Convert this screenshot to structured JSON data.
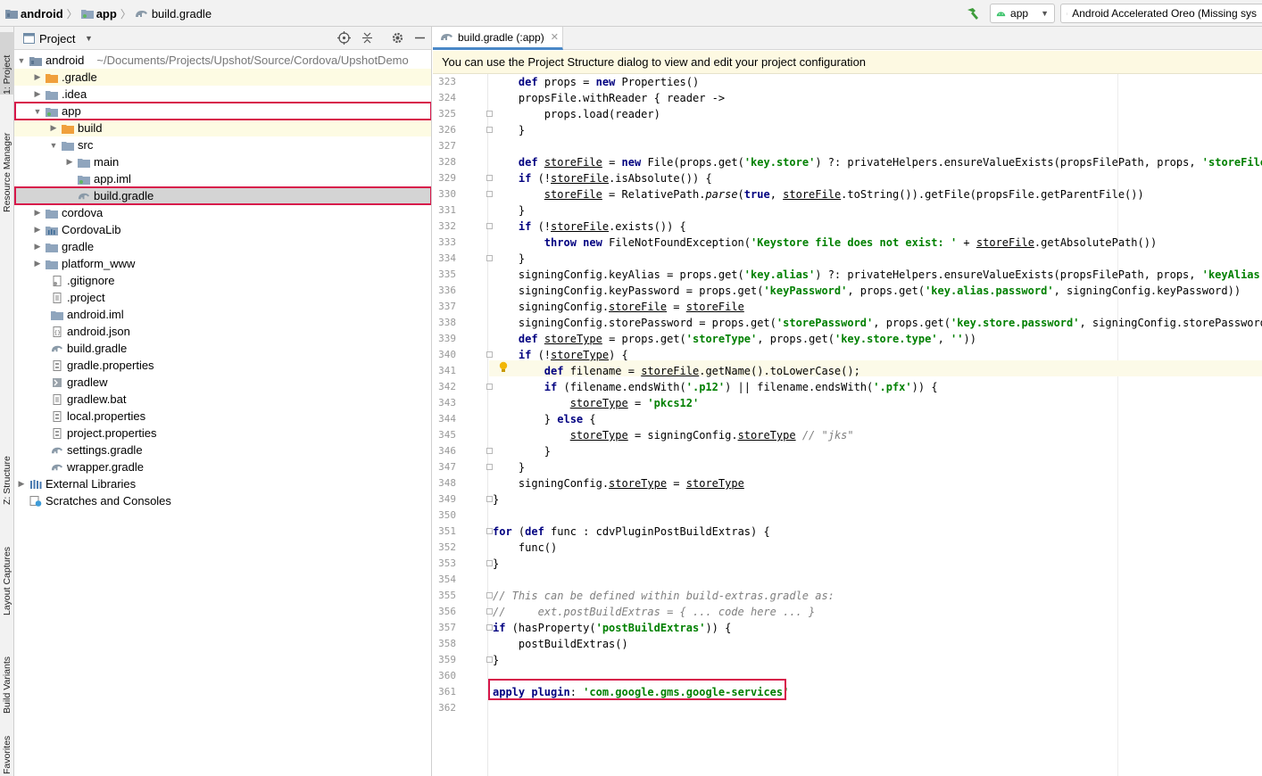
{
  "breadcrumb": {
    "root": "android",
    "module": "app",
    "file": "build.gradle"
  },
  "toolbar": {
    "run_config": "app",
    "device": "Android Accelerated Oreo (Missing sys"
  },
  "side_tabs": [
    "1: Project",
    "Resource Manager",
    "Z: Structure",
    "Layout Captures",
    "Build Variants",
    "Favorites"
  ],
  "project_panel": {
    "title": "Project",
    "tree": [
      {
        "label": "android",
        "path_hint": "~/Documents/Projects/Upshot/Source/Cordova/UpshotDemo"
      },
      {
        "label": ".gradle"
      },
      {
        "label": ".idea"
      },
      {
        "label": "app"
      },
      {
        "label": "build"
      },
      {
        "label": "src"
      },
      {
        "label": "main"
      },
      {
        "label": "app.iml"
      },
      {
        "label": "build.gradle"
      },
      {
        "label": "cordova"
      },
      {
        "label": "CordovaLib"
      },
      {
        "label": "gradle"
      },
      {
        "label": "platform_www"
      },
      {
        "label": ".gitignore"
      },
      {
        "label": ".project"
      },
      {
        "label": "android.iml"
      },
      {
        "label": "android.json"
      },
      {
        "label": "build.gradle"
      },
      {
        "label": "gradle.properties"
      },
      {
        "label": "gradlew"
      },
      {
        "label": "gradlew.bat"
      },
      {
        "label": "local.properties"
      },
      {
        "label": "project.properties"
      },
      {
        "label": "settings.gradle"
      },
      {
        "label": "wrapper.gradle"
      },
      {
        "label": "External Libraries"
      },
      {
        "label": "Scratches and Consoles"
      }
    ]
  },
  "editor": {
    "tab_label": "build.gradle (:app)",
    "banner": "You can use the Project Structure dialog to view and edit your project configuration",
    "lines": [
      {
        "n": "323",
        "t": "    def props = new Properties()"
      },
      {
        "n": "324",
        "t": "    propsFile.withReader { reader ->"
      },
      {
        "n": "325",
        "t": "        props.load(reader)"
      },
      {
        "n": "326",
        "t": "    }"
      },
      {
        "n": "327",
        "t": ""
      },
      {
        "n": "328",
        "t": "    def storeFile = new File(props.get('key.store') ?: privateHelpers.ensureValueExists(propsFilePath, props, 'storeFile'))"
      },
      {
        "n": "329",
        "t": "    if (!storeFile.isAbsolute()) {"
      },
      {
        "n": "330",
        "t": "        storeFile = RelativePath.parse(true, storeFile.toString()).getFile(propsFile.getParentFile())"
      },
      {
        "n": "331",
        "t": "    }"
      },
      {
        "n": "332",
        "t": "    if (!storeFile.exists()) {"
      },
      {
        "n": "333",
        "t": "        throw new FileNotFoundException('Keystore file does not exist: ' + storeFile.getAbsolutePath())"
      },
      {
        "n": "334",
        "t": "    }"
      },
      {
        "n": "335",
        "t": "    signingConfig.keyAlias = props.get('key.alias') ?: privateHelpers.ensureValueExists(propsFilePath, props, 'keyAlias')"
      },
      {
        "n": "336",
        "t": "    signingConfig.keyPassword = props.get('keyPassword', props.get('key.alias.password', signingConfig.keyPassword))"
      },
      {
        "n": "337",
        "t": "    signingConfig.storeFile = storeFile"
      },
      {
        "n": "338",
        "t": "    signingConfig.storePassword = props.get('storePassword', props.get('key.store.password', signingConfig.storePassword))"
      },
      {
        "n": "339",
        "t": "    def storeType = props.get('storeType', props.get('key.store.type', ''))"
      },
      {
        "n": "340",
        "t": "    if (!storeType) {"
      },
      {
        "n": "341",
        "t": "        def filename = storeFile.getName().toLowerCase();"
      },
      {
        "n": "342",
        "t": "        if (filename.endsWith('.p12') || filename.endsWith('.pfx')) {"
      },
      {
        "n": "343",
        "t": "            storeType = 'pkcs12'"
      },
      {
        "n": "344",
        "t": "        } else {"
      },
      {
        "n": "345",
        "t": "            storeType = signingConfig.storeType // \"jks\""
      },
      {
        "n": "346",
        "t": "        }"
      },
      {
        "n": "347",
        "t": "    }"
      },
      {
        "n": "348",
        "t": "    signingConfig.storeType = storeType"
      },
      {
        "n": "349",
        "t": "}"
      },
      {
        "n": "350",
        "t": ""
      },
      {
        "n": "351",
        "t": "for (def func : cdvPluginPostBuildExtras) {"
      },
      {
        "n": "352",
        "t": "    func()"
      },
      {
        "n": "353",
        "t": "}"
      },
      {
        "n": "354",
        "t": ""
      },
      {
        "n": "355",
        "t": "// This can be defined within build-extras.gradle as:"
      },
      {
        "n": "356",
        "t": "//     ext.postBuildExtras = { ... code here ... }"
      },
      {
        "n": "357",
        "t": "if (hasProperty('postBuildExtras')) {"
      },
      {
        "n": "358",
        "t": "    postBuildExtras()"
      },
      {
        "n": "359",
        "t": "}"
      },
      {
        "n": "360",
        "t": ""
      },
      {
        "n": "361",
        "t": "apply plugin: 'com.google.gms.google-services'"
      },
      {
        "n": "362",
        "t": ""
      }
    ]
  }
}
